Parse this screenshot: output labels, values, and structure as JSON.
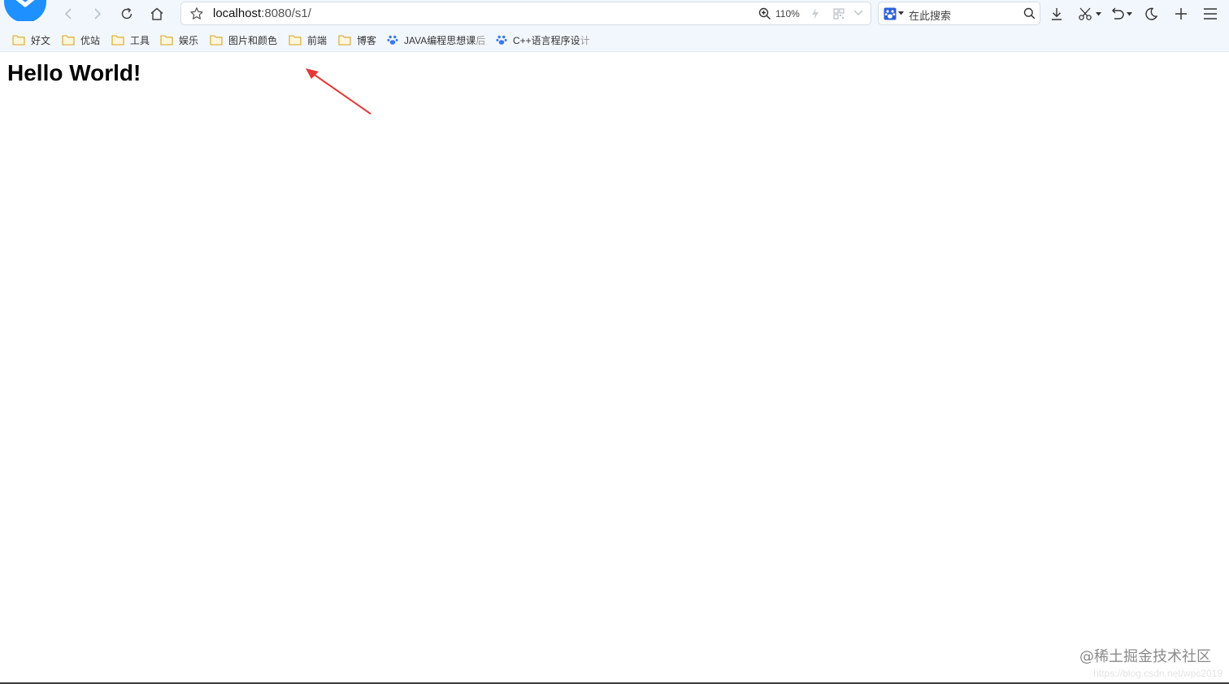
{
  "address_bar": {
    "url_host": "localhost",
    "url_rest": ":8080/s1/",
    "zoom": "110%"
  },
  "search": {
    "placeholder": "在此搜索"
  },
  "bookmarks": [
    {
      "label": "好文",
      "icon": "folder-icon"
    },
    {
      "label": "优站",
      "icon": "folder-icon"
    },
    {
      "label": "工具",
      "icon": "folder-icon"
    },
    {
      "label": "娱乐",
      "icon": "folder-icon"
    },
    {
      "label": "图片和颜色",
      "icon": "folder-icon"
    },
    {
      "label": "前端",
      "icon": "folder-icon"
    },
    {
      "label": "博客",
      "icon": "folder-icon"
    },
    {
      "label": "JAVA编程思想课",
      "fade": "后",
      "icon": "paw-icon"
    },
    {
      "label": "C++语言程序设",
      "fade": "计",
      "icon": "paw-icon"
    }
  ],
  "page": {
    "heading": "Hello World!"
  },
  "watermark": {
    "text": "@稀土掘金技术社区",
    "url": "https://blog.csdn.net/wpc2019"
  },
  "colors": {
    "toolbar_bg": "#f2f7fd",
    "logo_blue": "#1e90ff",
    "annotation_red": "#e53935"
  }
}
